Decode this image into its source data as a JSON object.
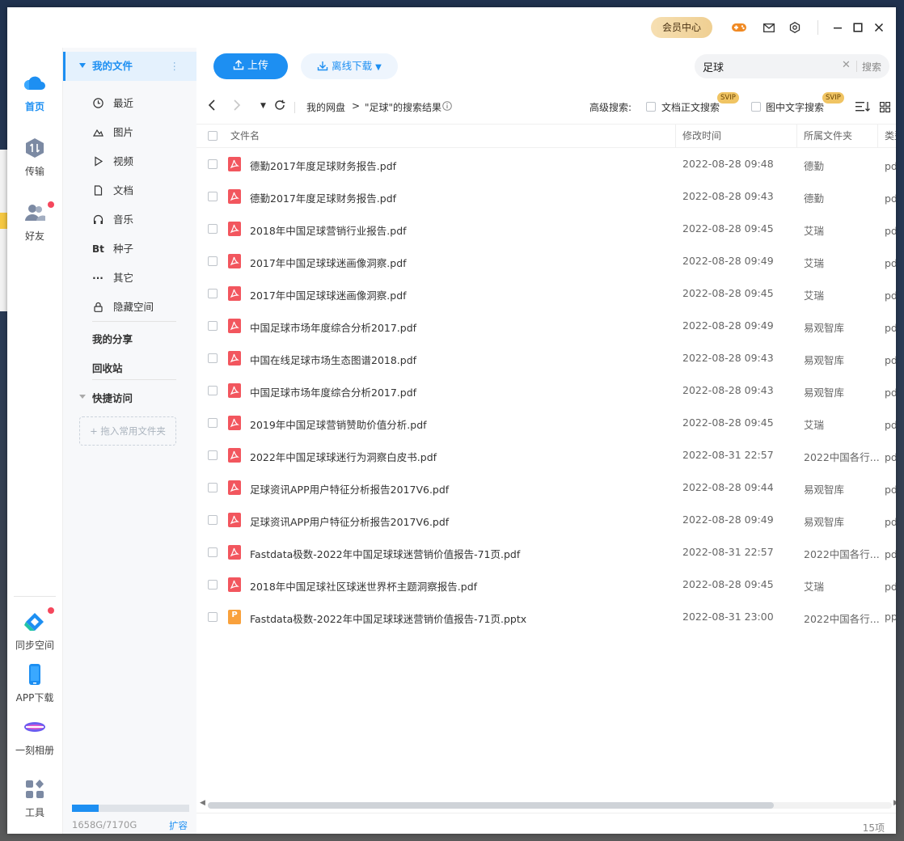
{
  "titlebar": {
    "vip_label": "会员中心"
  },
  "rail": {
    "items": [
      {
        "label": "首页",
        "icon": "cloud-icon"
      },
      {
        "label": "传输",
        "icon": "transfer-icon"
      },
      {
        "label": "好友",
        "icon": "friends-icon"
      },
      {
        "label": "同步空间",
        "icon": "sync-icon"
      },
      {
        "label": "APP下载",
        "icon": "phone-icon"
      },
      {
        "label": "一刻相册",
        "icon": "album-icon"
      },
      {
        "label": "工具",
        "icon": "tools-icon"
      }
    ]
  },
  "sidebar": {
    "my_files": "我的文件",
    "categories": [
      {
        "label": "最近",
        "icon": "clock-icon"
      },
      {
        "label": "图片",
        "icon": "image-icon"
      },
      {
        "label": "视频",
        "icon": "play-icon"
      },
      {
        "label": "文档",
        "icon": "doc-icon"
      },
      {
        "label": "音乐",
        "icon": "headphones-icon"
      },
      {
        "label": "种子",
        "icon": "bt-icon"
      },
      {
        "label": "其它",
        "icon": "more-icon"
      },
      {
        "label": "隐藏空间",
        "icon": "lock-icon"
      }
    ],
    "my_share": "我的分享",
    "recycle": "回收站",
    "quick_access": "快捷访问",
    "drop_hint": "+ 拖入常用文件夹",
    "storage_text": "1658G/7170G",
    "storage_used_fraction": 0.231,
    "expand_label": "扩容"
  },
  "toolbar": {
    "upload": "上传",
    "offline": "离线下载",
    "search_value": "足球",
    "search_btn": "搜索"
  },
  "nav": {
    "root": "我的网盘",
    "sep": ">",
    "result": "\"足球\"的搜索结果",
    "adv_label": "高级搜索:",
    "fulltext": "文档正文搜索",
    "imagetext": "图中文字搜索",
    "svip": "SVIP"
  },
  "table": {
    "headers": {
      "name": "文件名",
      "time": "修改时间",
      "folder": "所属文件夹",
      "type": "类型"
    },
    "rows": [
      {
        "name": "德勤2017年度足球财务报告.pdf",
        "time": "2022-08-28 09:48",
        "folder": "德勤",
        "type": "pdf文",
        "kind": "pdf"
      },
      {
        "name": "德勤2017年度足球财务报告.pdf",
        "time": "2022-08-28 09:43",
        "folder": "德勤",
        "type": "pdf文",
        "kind": "pdf"
      },
      {
        "name": "2018年中国足球营销行业报告.pdf",
        "time": "2022-08-28 09:45",
        "folder": "艾瑞",
        "type": "pdf文",
        "kind": "pdf"
      },
      {
        "name": "2017年中国足球球迷画像洞察.pdf",
        "time": "2022-08-28 09:49",
        "folder": "艾瑞",
        "type": "pdf文",
        "kind": "pdf"
      },
      {
        "name": "2017年中国足球球迷画像洞察.pdf",
        "time": "2022-08-28 09:45",
        "folder": "艾瑞",
        "type": "pdf文",
        "kind": "pdf"
      },
      {
        "name": "中国足球市场年度综合分析2017.pdf",
        "time": "2022-08-28 09:49",
        "folder": "易观智库",
        "type": "pdf文",
        "kind": "pdf"
      },
      {
        "name": "中国在线足球市场生态图谱2018.pdf",
        "time": "2022-08-28 09:43",
        "folder": "易观智库",
        "type": "pdf文",
        "kind": "pdf"
      },
      {
        "name": "中国足球市场年度综合分析2017.pdf",
        "time": "2022-08-28 09:43",
        "folder": "易观智库",
        "type": "pdf文",
        "kind": "pdf"
      },
      {
        "name": "2019年中国足球营销赞助价值分析.pdf",
        "time": "2022-08-28 09:45",
        "folder": "艾瑞",
        "type": "pdf文",
        "kind": "pdf"
      },
      {
        "name": "2022年中国足球球迷行为洞察白皮书.pdf",
        "time": "2022-08-31 22:57",
        "folder": "2022中国各行...",
        "type": "pdf文",
        "kind": "pdf"
      },
      {
        "name": "足球资讯APP用户特征分析报告2017V6.pdf",
        "time": "2022-08-28 09:44",
        "folder": "易观智库",
        "type": "pdf文",
        "kind": "pdf"
      },
      {
        "name": "足球资讯APP用户特征分析报告2017V6.pdf",
        "time": "2022-08-28 09:49",
        "folder": "易观智库",
        "type": "pdf文",
        "kind": "pdf"
      },
      {
        "name": "Fastdata极数-2022年中国足球球迷营销价值报告-71页.pdf",
        "time": "2022-08-31 22:57",
        "folder": "2022中国各行...",
        "type": "pdf文",
        "kind": "pdf"
      },
      {
        "name": "2018年中国足球社区球迷世界杯主题洞察报告.pdf",
        "time": "2022-08-28 09:45",
        "folder": "艾瑞",
        "type": "pdf文",
        "kind": "pdf"
      },
      {
        "name": "Fastdata极数-2022年中国足球球迷营销价值报告-71页.pptx",
        "time": "2022-08-31 23:00",
        "folder": "2022中国各行...",
        "type": "pptx",
        "kind": "pptx"
      }
    ]
  },
  "footer": {
    "count": "15项"
  },
  "colors": {
    "accent": "#1d8ff2",
    "pdf": "#f2565e",
    "pptx": "#f9a13c",
    "badge": "#f5475c"
  }
}
